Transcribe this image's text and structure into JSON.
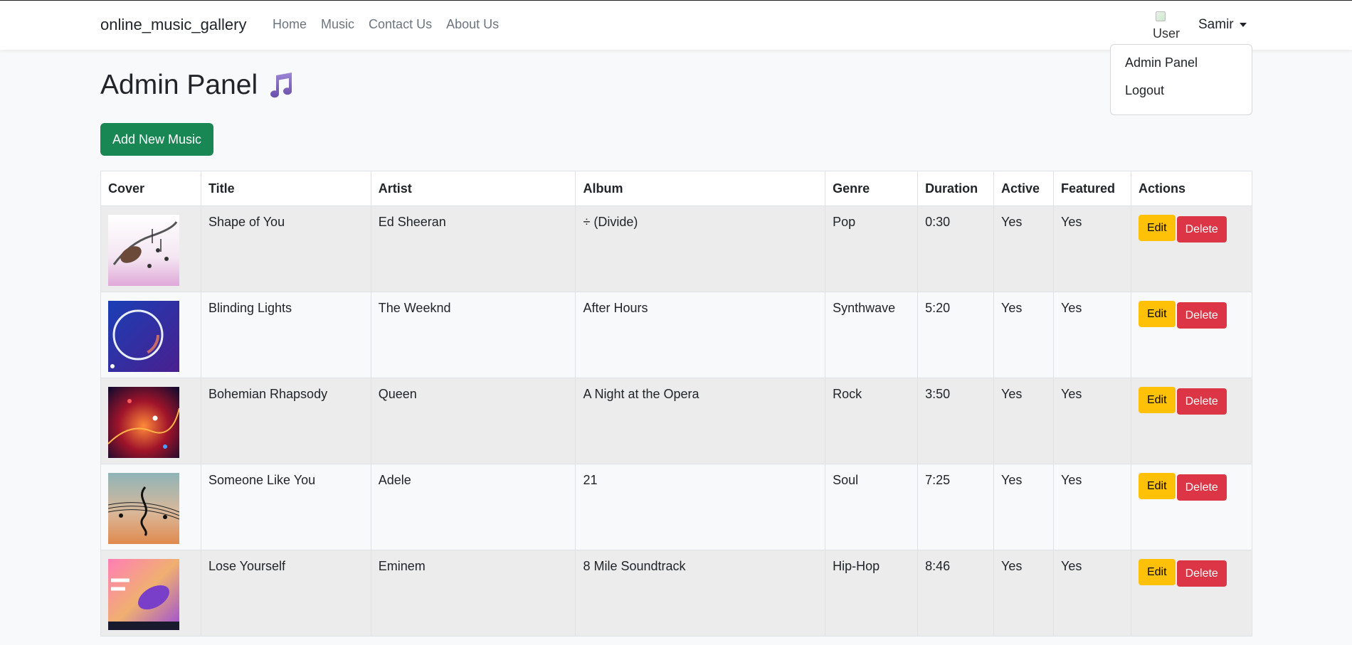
{
  "navbar": {
    "brand": "online_music_gallery",
    "links": [
      "Home",
      "Music",
      "Contact Us",
      "About Us"
    ],
    "avatar_alt": "User",
    "username": "Samir"
  },
  "dropdown": {
    "items": [
      "Admin Panel",
      "Logout"
    ]
  },
  "page": {
    "title": "Admin Panel",
    "add_button": "Add New Music"
  },
  "table": {
    "headers": [
      "Cover",
      "Title",
      "Artist",
      "Album",
      "Genre",
      "Duration",
      "Active",
      "Featured",
      "Actions"
    ],
    "rows": [
      {
        "title": "Shape of You",
        "artist": "Ed Sheeran",
        "album": "÷ (Divide)",
        "genre": "Pop",
        "duration": "0:30",
        "active": "Yes",
        "featured": "Yes"
      },
      {
        "title": "Blinding Lights",
        "artist": "The Weeknd",
        "album": "After Hours",
        "genre": "Synthwave",
        "duration": "5:20",
        "active": "Yes",
        "featured": "Yes"
      },
      {
        "title": "Bohemian Rhapsody",
        "artist": "Queen",
        "album": "A Night at the Opera",
        "genre": "Rock",
        "duration": "3:50",
        "active": "Yes",
        "featured": "Yes"
      },
      {
        "title": "Someone Like You",
        "artist": "Adele",
        "album": "21",
        "genre": "Soul",
        "duration": "7:25",
        "active": "Yes",
        "featured": "Yes"
      },
      {
        "title": "Lose Yourself",
        "artist": "Eminem",
        "album": "8 Mile Soundtrack",
        "genre": "Hip-Hop",
        "duration": "8:46",
        "active": "Yes",
        "featured": "Yes"
      }
    ],
    "edit_label": "Edit",
    "delete_label": "Delete"
  },
  "colors": {
    "add_button": "#198754",
    "edit_button": "#ffc107",
    "delete_button": "#dc3545",
    "music_icon": "#7b5fb4"
  },
  "icons": {
    "page_title": "music-note-icon",
    "user_menu": "chevron-down-icon"
  }
}
